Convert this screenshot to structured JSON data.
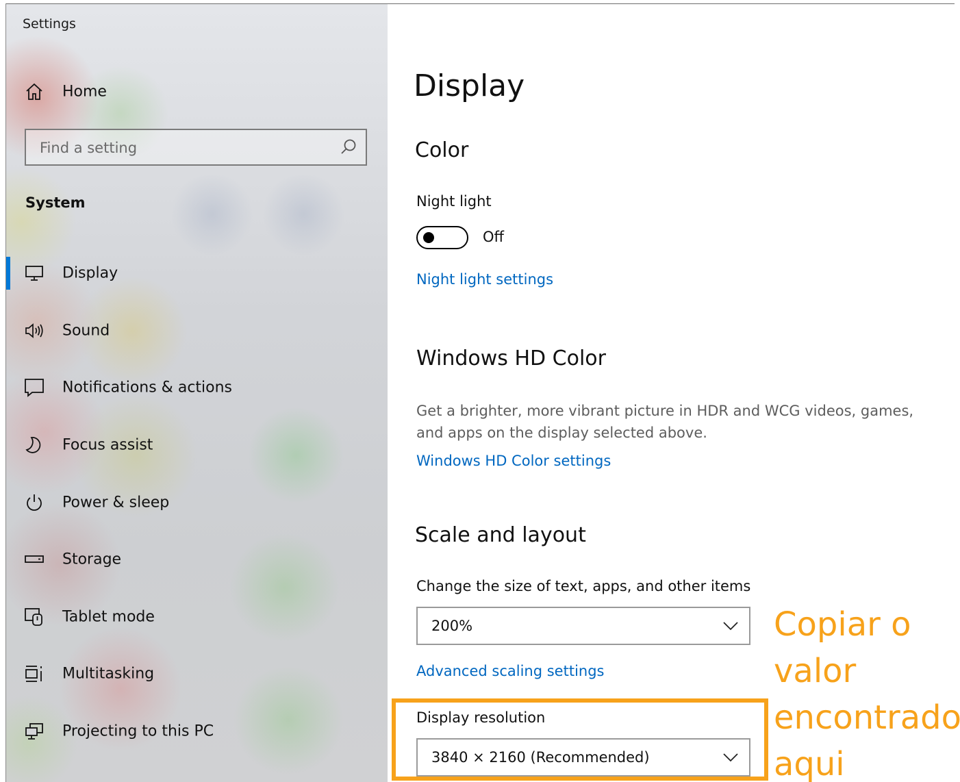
{
  "window": {
    "app_title": "Settings"
  },
  "sidebar": {
    "home_label": "Home",
    "search_placeholder": "Find a setting",
    "section_heading": "System",
    "items": [
      {
        "label": "Display",
        "icon": "monitor-icon",
        "active": true
      },
      {
        "label": "Sound",
        "icon": "speaker-icon"
      },
      {
        "label": "Notifications & actions",
        "icon": "message-icon"
      },
      {
        "label": "Focus assist",
        "icon": "moon-icon"
      },
      {
        "label": "Power & sleep",
        "icon": "power-icon"
      },
      {
        "label": "Storage",
        "icon": "storage-icon"
      },
      {
        "label": "Tablet mode",
        "icon": "tablet-icon"
      },
      {
        "label": "Multitasking",
        "icon": "multitasking-icon"
      },
      {
        "label": "Projecting to this PC",
        "icon": "projector-icon"
      }
    ]
  },
  "main": {
    "page_title": "Display",
    "color": {
      "heading": "Color",
      "night_light_label": "Night light",
      "night_light_state": "Off",
      "night_light_on": false,
      "night_light_settings_link": "Night light settings"
    },
    "hd_color": {
      "heading": "Windows HD Color",
      "description": "Get a brighter, more vibrant picture in HDR and WCG videos, games, and apps on the display selected above.",
      "settings_link": "Windows HD Color settings"
    },
    "scale_layout": {
      "heading": "Scale and layout",
      "scale_label": "Change the size of text, apps, and other items",
      "scale_value": "200%",
      "advanced_link": "Advanced scaling settings",
      "resolution_label": "Display resolution",
      "resolution_value": "3840 × 2160 (Recommended)"
    }
  },
  "annotation": {
    "text": "Copiar o valor encontrado aqui",
    "color": "#f7a21b"
  },
  "colors": {
    "accent": "#0078d7",
    "link": "#0067c0"
  }
}
